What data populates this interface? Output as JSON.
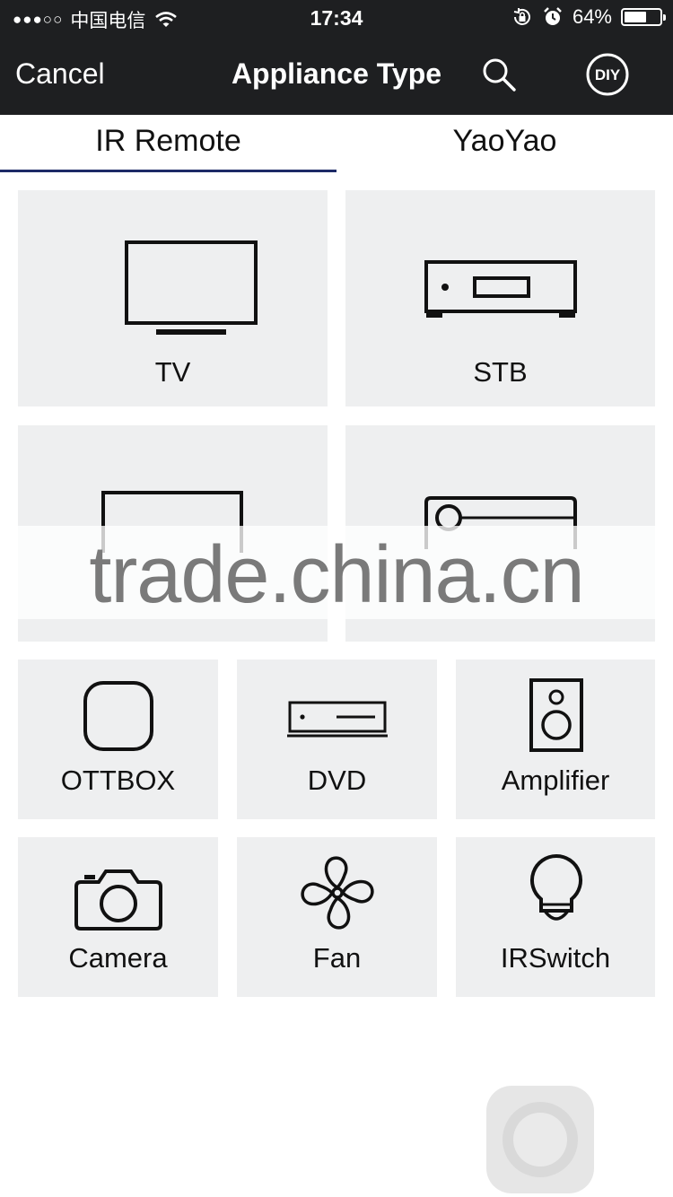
{
  "status_bar": {
    "signal_dots": "●●●○○",
    "carrier": "中国电信",
    "time": "17:34",
    "battery_percent": "64%",
    "battery_level": 0.64
  },
  "header": {
    "cancel_label": "Cancel",
    "title": "Appliance Type",
    "search_icon": "search-icon",
    "diy_label": "DIY"
  },
  "tabs": [
    {
      "label": "IR Remote",
      "selected": true
    },
    {
      "label": "YaoYao",
      "selected": false
    }
  ],
  "appliances": {
    "tv": "TV",
    "stb": "STB",
    "ottbox": "OTTBOX",
    "dvd": "DVD",
    "amplifier": "Amplifier",
    "camera": "Camera",
    "fan": "Fan",
    "irswitch": "IRSwitch"
  },
  "watermark": "trade.china.cn",
  "colors": {
    "header_bg": "#1e1f21",
    "tile_bg": "#eeeff0",
    "tab_underline": "#1d2a66"
  }
}
